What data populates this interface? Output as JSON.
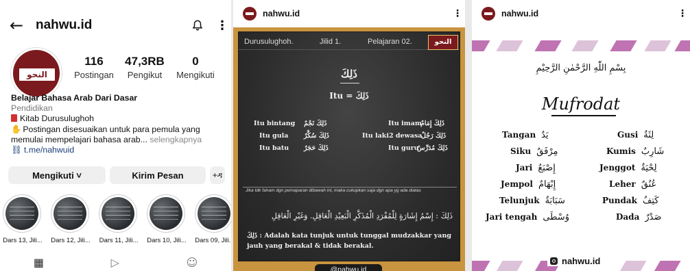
{
  "profile": {
    "username": "nahwu.id",
    "stats": [
      {
        "num": "116",
        "label": "Postingan"
      },
      {
        "num": "47,3RB",
        "label": "Pengikut"
      },
      {
        "num": "0",
        "label": "Mengikuti"
      }
    ],
    "bio": {
      "name": "Belajar Bahasa Arab Dari Dasar",
      "category": "Pendidikan",
      "line1": "Kitab Durusulughoh",
      "line2": "Postingan disesuaikan untuk para pemula yang",
      "line3": "memulai mempelajari bahasa arab...",
      "more": "selengkapnya",
      "link": "t.me/nahwuid"
    },
    "buttons": {
      "follow": "Mengikuti ˅",
      "message": "Kirim Pesan",
      "add": "+ዳ"
    },
    "highlights": [
      "Dars 13, Jili...",
      "Dars 12, Jili...",
      "Dars 11, Jili...",
      "Dars 10, Jili...",
      "Dars 09, Jili..."
    ],
    "tabs": {
      "grid": "▦",
      "reels": "▷",
      "tagged": "☺"
    }
  },
  "post1": {
    "username": "nahwu.id",
    "header": {
      "series": "Durusulughoh.",
      "jilid": "Jilid 1.",
      "lesson": "Pelajaran 02."
    },
    "logo_text": "النحو",
    "title": "ذَلِكَ",
    "itu": "Itu = ذَلِكَ",
    "rows_left": [
      {
        "id": "Itu bintang",
        "ar": "ذَلِكَ نَجْمٌ"
      },
      {
        "id": "Itu gula",
        "ar": "ذَلِكَ سُكَّرٌ"
      },
      {
        "id": "Itu batu",
        "ar": "ذَلِكَ حَجَرٌ"
      }
    ],
    "rows_right": [
      {
        "id": "Itu imam",
        "ar": "ذَلِكَ إِمَامٌ"
      },
      {
        "id": "Itu laki2 dewasa",
        "ar": "ذَلِكَ رَجُلٌ"
      },
      {
        "id": "Itu guru",
        "ar": "ذَلِكَ مُدَرِّسٌ"
      }
    ],
    "note": "Jika tdk faham dgn pemaparan dibawah ini, maka cukupkan saja dgn apa yg ada diatas",
    "def_ar": "ذَلِكَ : إِسْمُ إِشَارَةٍ لِلْمُفْرَدِ الْمُذَكَّرِ الْبَعِيْدِ الْعَاقِلِ. وَغَيْرِ الْعَاقِلِ",
    "def_id": "ذَلِكَ : Adalah kata tunjuk untuk tunggal mudzakkar yang jauh yang berakal & tidak berakal.",
    "credit": "@nahwu.id"
  },
  "post2": {
    "username": "nahwu.id",
    "basmalah": "بِسْمِ اللّٰهِ الرَّحْمٰنِ الرَّحِيْمِ",
    "title": "Mufrodat",
    "left": [
      {
        "id": "Tangan",
        "ar": "يَدٌ"
      },
      {
        "id": "Siku",
        "ar": "مِرْفَقٌ"
      },
      {
        "id": "Jari",
        "ar": "إِصْبَعٌ"
      },
      {
        "id": "Jempol",
        "ar": "إِبْهَامٌ"
      },
      {
        "id": "Telunjuk",
        "ar": "سَبَابَةٌ"
      },
      {
        "id": "Jari tengah",
        "ar": "وُسْطَى"
      }
    ],
    "right": [
      {
        "id": "Gusi",
        "ar": "لِثَةٌ"
      },
      {
        "id": "Kumis",
        "ar": "شَارِبٌ"
      },
      {
        "id": "Jenggot",
        "ar": "لِحْيَةٌ"
      },
      {
        "id": "Leher",
        "ar": "عُنُقٌ"
      },
      {
        "id": "Pundak",
        "ar": "كَتِفٌ"
      },
      {
        "id": "Dada",
        "ar": "صَدْرٌ"
      }
    ],
    "brand": "nahwu.id"
  },
  "colors": {
    "brand": "#7b1a1e",
    "frame": "#c9943f",
    "chalkboard": "#2b2b2b",
    "accent_purple": "#b45aa6",
    "link": "#1a3e7a"
  }
}
